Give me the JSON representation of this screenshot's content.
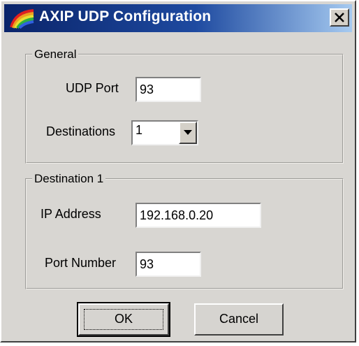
{
  "window": {
    "title": "AXIP UDP Configuration",
    "icon": "rainbow-app-icon",
    "close_icon": "close-icon"
  },
  "general": {
    "legend": "General",
    "udp_port_label": "UDP Port",
    "udp_port_value": "93",
    "destinations_label": "Destinations",
    "destinations_value": "1"
  },
  "destination": {
    "legend": "Destination 1",
    "ip_label": "IP Address",
    "ip_value": "192.168.0.20",
    "port_label": "Port Number",
    "port_value": "93"
  },
  "buttons": {
    "ok": "OK",
    "cancel": "Cancel"
  },
  "colors": {
    "title_start": "#0a246a",
    "title_end": "#a6caf0",
    "face": "#d8d6d2"
  }
}
